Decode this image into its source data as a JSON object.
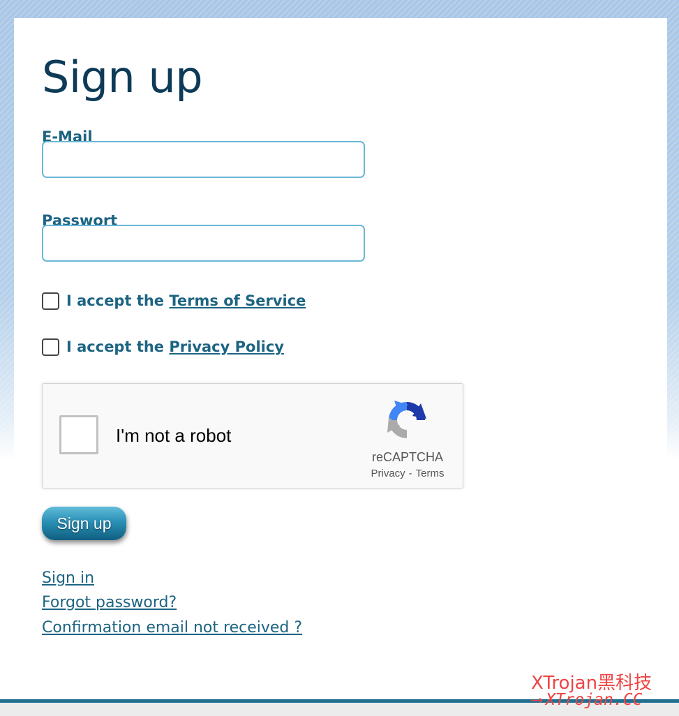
{
  "form": {
    "title": "Sign up",
    "email_label": "E-Mail",
    "email_value": "",
    "password_label": "Passwort",
    "password_value": "",
    "terms_prefix": "I accept the",
    "terms_link": "Terms of Service",
    "terms_checked": false,
    "privacy_prefix": "I accept the",
    "privacy_link": "Privacy Policy",
    "privacy_checked": false,
    "submit_label": "Sign up"
  },
  "recaptcha": {
    "checkbox_text": "I'm not a robot",
    "checked": false,
    "brand": "reCAPTCHA",
    "privacy_link": "Privacy",
    "separator": "-",
    "terms_link": "Terms"
  },
  "links": {
    "sign_in": "Sign in",
    "forgot_password": "Forgot password?",
    "confirmation_email": "Confirmation email not received ?"
  },
  "watermark": {
    "line1": "XTrojan黑科技",
    "line2": "XTrojan.CC"
  },
  "colors": {
    "heading": "#0d3b57",
    "label": "#1d6482",
    "input_border": "#6ab7d6",
    "button": "#2a90b6",
    "footer_line": "#1f6f8f",
    "watermark": "#ee4444"
  }
}
